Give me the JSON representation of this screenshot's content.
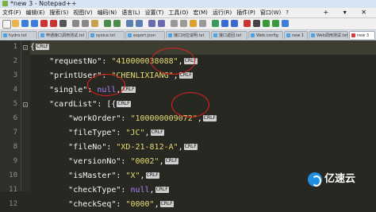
{
  "window": {
    "title": "*new 3 - Notepad++"
  },
  "menu": {
    "items": [
      "文件(F)",
      "编辑(E)",
      "搜索(S)",
      "视图(V)",
      "编码(N)",
      "语言(L)",
      "设置(T)",
      "工具(O)",
      "宏(M)",
      "运行(R)",
      "插件(P)",
      "窗口(W)",
      "?"
    ],
    "window_controls": "+ ▾ ✕"
  },
  "tabs": [
    {
      "label": "hydro.txt"
    },
    {
      "label": "申通接口调用测试.txt"
    },
    {
      "label": "syoice.txt"
    },
    {
      "label": "export.json"
    },
    {
      "label": "接口对应说明.txt"
    },
    {
      "label": "接口返回.txt"
    },
    {
      "label": "Web.config"
    },
    {
      "label": "new 1"
    },
    {
      "label": "Web调用测试.txt"
    },
    {
      "label": "new 3"
    }
  ],
  "editor": {
    "eol_marker": "CRLF",
    "lines": [
      {
        "number": "1",
        "tokens": [
          {
            "t": "{",
            "c": "p"
          }
        ]
      },
      {
        "number": "2",
        "tokens": [
          {
            "t": "    ",
            "c": "p"
          },
          {
            "t": "\"requestNo\"",
            "c": "k"
          },
          {
            "t": ": ",
            "c": "p"
          },
          {
            "t": "\"410000038088\"",
            "c": "s"
          },
          {
            "t": ",",
            "c": "p"
          }
        ]
      },
      {
        "number": "3",
        "tokens": [
          {
            "t": "    ",
            "c": "p"
          },
          {
            "t": "\"printUser\"",
            "c": "k"
          },
          {
            "t": ": ",
            "c": "p"
          },
          {
            "t": "\"CHENLIXIANG\"",
            "c": "s"
          },
          {
            "t": ",",
            "c": "p"
          }
        ]
      },
      {
        "number": "4",
        "tokens": [
          {
            "t": "    ",
            "c": "p"
          },
          {
            "t": "\"single\"",
            "c": "k"
          },
          {
            "t": ": ",
            "c": "p"
          },
          {
            "t": "null",
            "c": "n"
          },
          {
            "t": ",",
            "c": "p"
          }
        ]
      },
      {
        "number": "5",
        "tokens": [
          {
            "t": "    ",
            "c": "p"
          },
          {
            "t": "\"cardList\"",
            "c": "k"
          },
          {
            "t": ": ",
            "c": "p"
          },
          {
            "t": "[{",
            "c": "p"
          }
        ]
      },
      {
        "number": "6",
        "tokens": [
          {
            "t": "        ",
            "c": "p"
          },
          {
            "t": "\"workOrder\"",
            "c": "k"
          },
          {
            "t": ": ",
            "c": "p"
          },
          {
            "t": "\"100000009072\"",
            "c": "s"
          },
          {
            "t": ",",
            "c": "p"
          }
        ]
      },
      {
        "number": "7",
        "tokens": [
          {
            "t": "        ",
            "c": "p"
          },
          {
            "t": "\"fileType\"",
            "c": "k"
          },
          {
            "t": ": ",
            "c": "p"
          },
          {
            "t": "\"JC\"",
            "c": "s"
          },
          {
            "t": ",",
            "c": "p"
          }
        ]
      },
      {
        "number": "8",
        "tokens": [
          {
            "t": "        ",
            "c": "p"
          },
          {
            "t": "\"fileNo\"",
            "c": "k"
          },
          {
            "t": ": ",
            "c": "p"
          },
          {
            "t": "\"XD-21-812-A\"",
            "c": "s"
          },
          {
            "t": ",",
            "c": "p"
          }
        ]
      },
      {
        "number": "9",
        "tokens": [
          {
            "t": "        ",
            "c": "p"
          },
          {
            "t": "\"versionNo\"",
            "c": "k"
          },
          {
            "t": ": ",
            "c": "p"
          },
          {
            "t": "\"0002\"",
            "c": "s"
          },
          {
            "t": ",",
            "c": "p"
          }
        ]
      },
      {
        "number": "10",
        "tokens": [
          {
            "t": "        ",
            "c": "p"
          },
          {
            "t": "\"isMaster\"",
            "c": "k"
          },
          {
            "t": ": ",
            "c": "p"
          },
          {
            "t": "\"X\"",
            "c": "s"
          },
          {
            "t": ",",
            "c": "p"
          }
        ]
      },
      {
        "number": "11",
        "tokens": [
          {
            "t": "        ",
            "c": "p"
          },
          {
            "t": "\"checkType\"",
            "c": "k"
          },
          {
            "t": ": ",
            "c": "p"
          },
          {
            "t": "null",
            "c": "n"
          },
          {
            "t": ",",
            "c": "p"
          }
        ]
      },
      {
        "number": "12",
        "tokens": [
          {
            "t": "        ",
            "c": "p"
          },
          {
            "t": "\"checkSeq\"",
            "c": "k"
          },
          {
            "t": ": ",
            "c": "p"
          },
          {
            "t": "\"0000\"",
            "c": "s"
          },
          {
            "t": ",",
            "c": "p"
          }
        ]
      }
    ]
  },
  "watermark": {
    "text": "亿速云"
  },
  "colors": {
    "background": "#272822",
    "string": "#e6db74",
    "null": "#ae81ff",
    "annotation": "#e02020"
  }
}
